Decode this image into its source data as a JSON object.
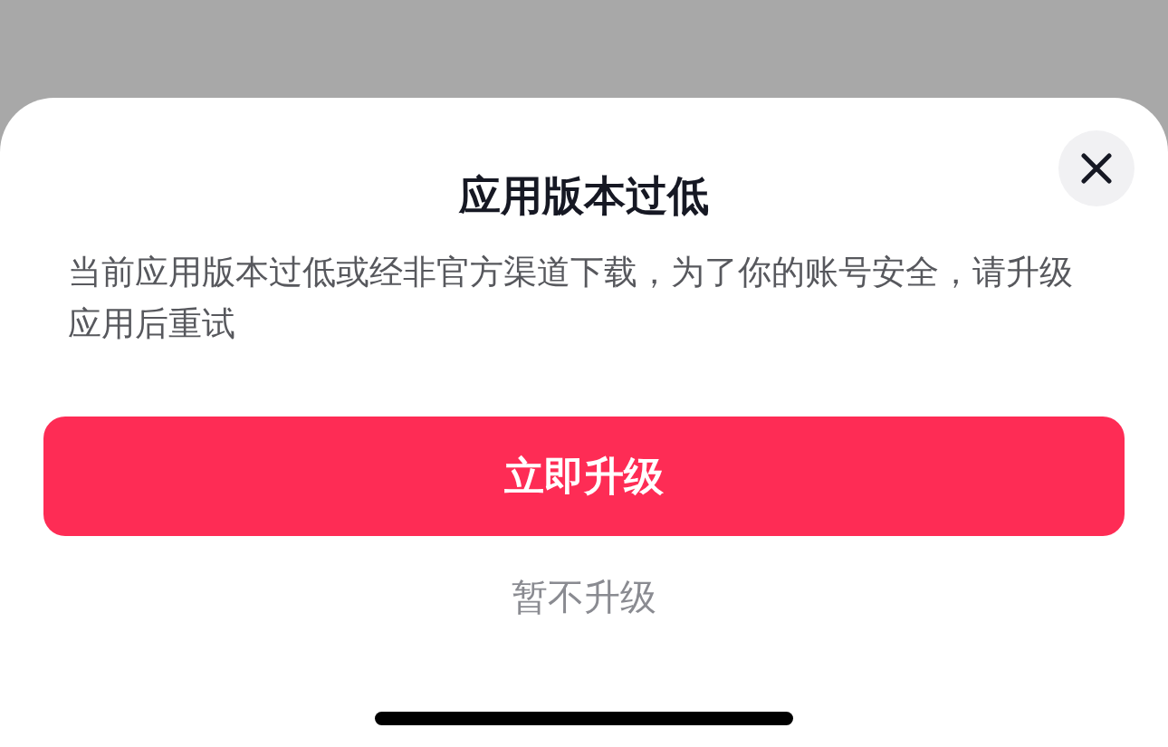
{
  "dialog": {
    "title": "应用版本过低",
    "message": "当前应用版本过低或经非官方渠道下载，为了你的账号安全，请升级应用后重试",
    "primary_button": "立即升级",
    "secondary_button": "暂不升级"
  }
}
